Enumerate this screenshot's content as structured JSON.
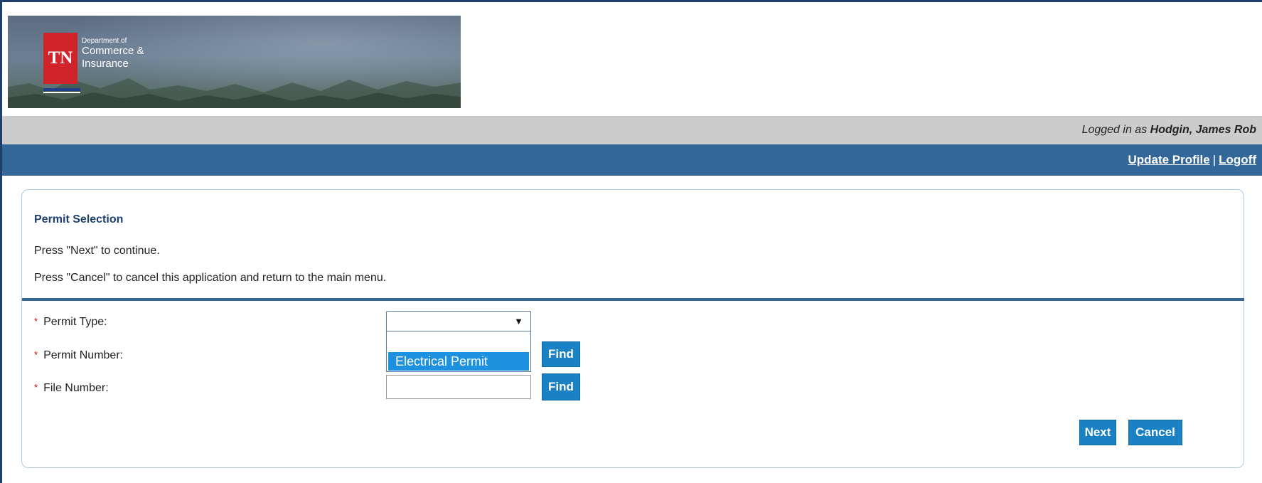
{
  "header": {
    "logo": {
      "mark": "TN",
      "line1": "Department of",
      "line2": "Commerce &",
      "line3": "Insurance"
    }
  },
  "status": {
    "prefix": "Logged in as ",
    "user": "Hodgin, James Rob"
  },
  "nav": {
    "update_profile": "Update Profile",
    "separator": "|",
    "logoff": "Logoff"
  },
  "form": {
    "title": "Permit Selection",
    "instruction_next": "Press \"Next\" to continue.",
    "instruction_cancel": "Press \"Cancel\" to cancel this application and return to the main menu.",
    "required_marker": "*",
    "fields": {
      "permit_type": {
        "label": "Permit Type:",
        "selected": "",
        "options": [
          "",
          "Electrical Permit"
        ]
      },
      "permit_number": {
        "label": "Permit Number:",
        "value": ""
      },
      "file_number": {
        "label": "File Number:",
        "value": ""
      }
    },
    "buttons": {
      "find": "Find",
      "next": "Next",
      "cancel": "Cancel"
    }
  },
  "icons": {
    "dropdown_arrow": "chevron-down-icon",
    "required": "asterisk-icon"
  },
  "colors": {
    "accent": "#336699",
    "button": "#1a82c4",
    "required": "#dd0000",
    "selected_option": "#1e90e0"
  }
}
